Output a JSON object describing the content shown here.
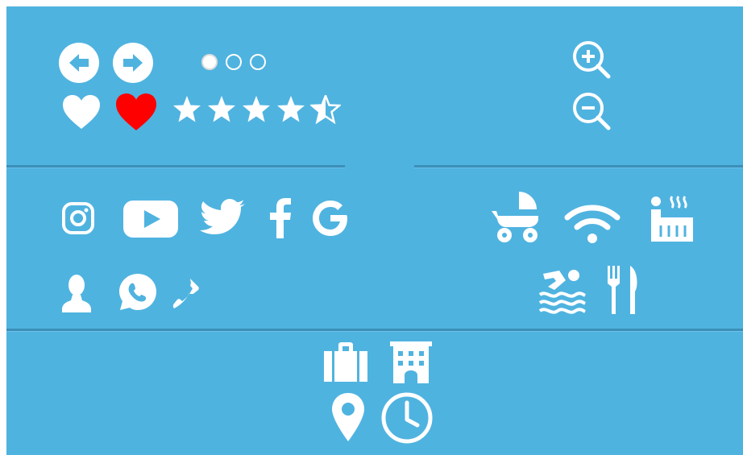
{
  "colors": {
    "background": "#4fb3e0",
    "icon": "#ffffff",
    "accent": "#ff0000",
    "divider": "#3b8fb8"
  },
  "navigation": {
    "arrows": [
      "arrow-left-icon",
      "arrow-right-icon"
    ],
    "carousel_dots": {
      "count": 3,
      "active_index": 0
    }
  },
  "favorites": [
    "heart-outline-icon",
    "heart-filled-icon"
  ],
  "rating": {
    "value": 4.5,
    "max": 5
  },
  "zoom_controls": [
    "zoom-in-icon",
    "zoom-out-icon"
  ],
  "social": [
    "instagram-icon",
    "youtube-icon",
    "twitter-icon",
    "facebook-icon",
    "google-icon"
  ],
  "contact": [
    "user-icon",
    "whatsapp-icon",
    "phone-icon"
  ],
  "amenities": [
    "stroller-icon",
    "wifi-icon",
    "sauna-icon",
    "pool-icon",
    "restaurant-icon"
  ],
  "travel": [
    "luggage-icon",
    "hotel-icon",
    "location-pin-icon",
    "clock-icon"
  ]
}
